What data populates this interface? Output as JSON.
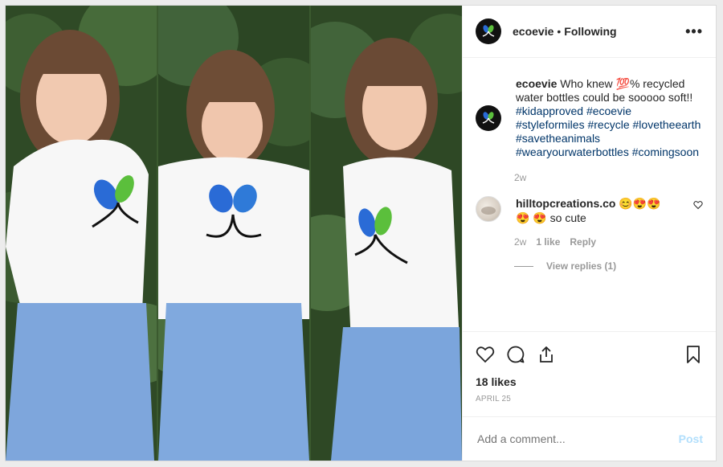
{
  "header": {
    "username": "ecoevie",
    "separator": "•",
    "following_label": "Following",
    "more_label": "•••"
  },
  "caption": {
    "username": "ecoevie",
    "text_before_emoji": "Who knew",
    "emoji": "💯",
    "text_after_emoji": "% recycled water bottles could be sooooo soft!!",
    "hashtags": [
      "#kidapproved",
      "#ecoevie",
      "#styleformiles",
      "#recycle",
      "#lovetheearth",
      "#savetheanimals",
      "#wearyourwaterbottles",
      "#comingsoon"
    ],
    "time": "2w"
  },
  "comment": {
    "username": "hilltopcreations.co",
    "emojis": "😊😍😍😍",
    "emoji2": "😍",
    "text": "so cute",
    "time": "2w",
    "likes": "1 like",
    "reply_label": "Reply",
    "view_replies": "View replies (1)"
  },
  "actions": {
    "likes": "18 likes",
    "date": "APRIL 25"
  },
  "add_comment": {
    "placeholder": "Add a comment...",
    "post_label": "Post"
  },
  "colors": {
    "hashtag": "#003569",
    "muted": "#999999",
    "post_button": "#b2dffc",
    "logo_blue": "#2a6bd6",
    "logo_green": "#5bbf3c"
  }
}
